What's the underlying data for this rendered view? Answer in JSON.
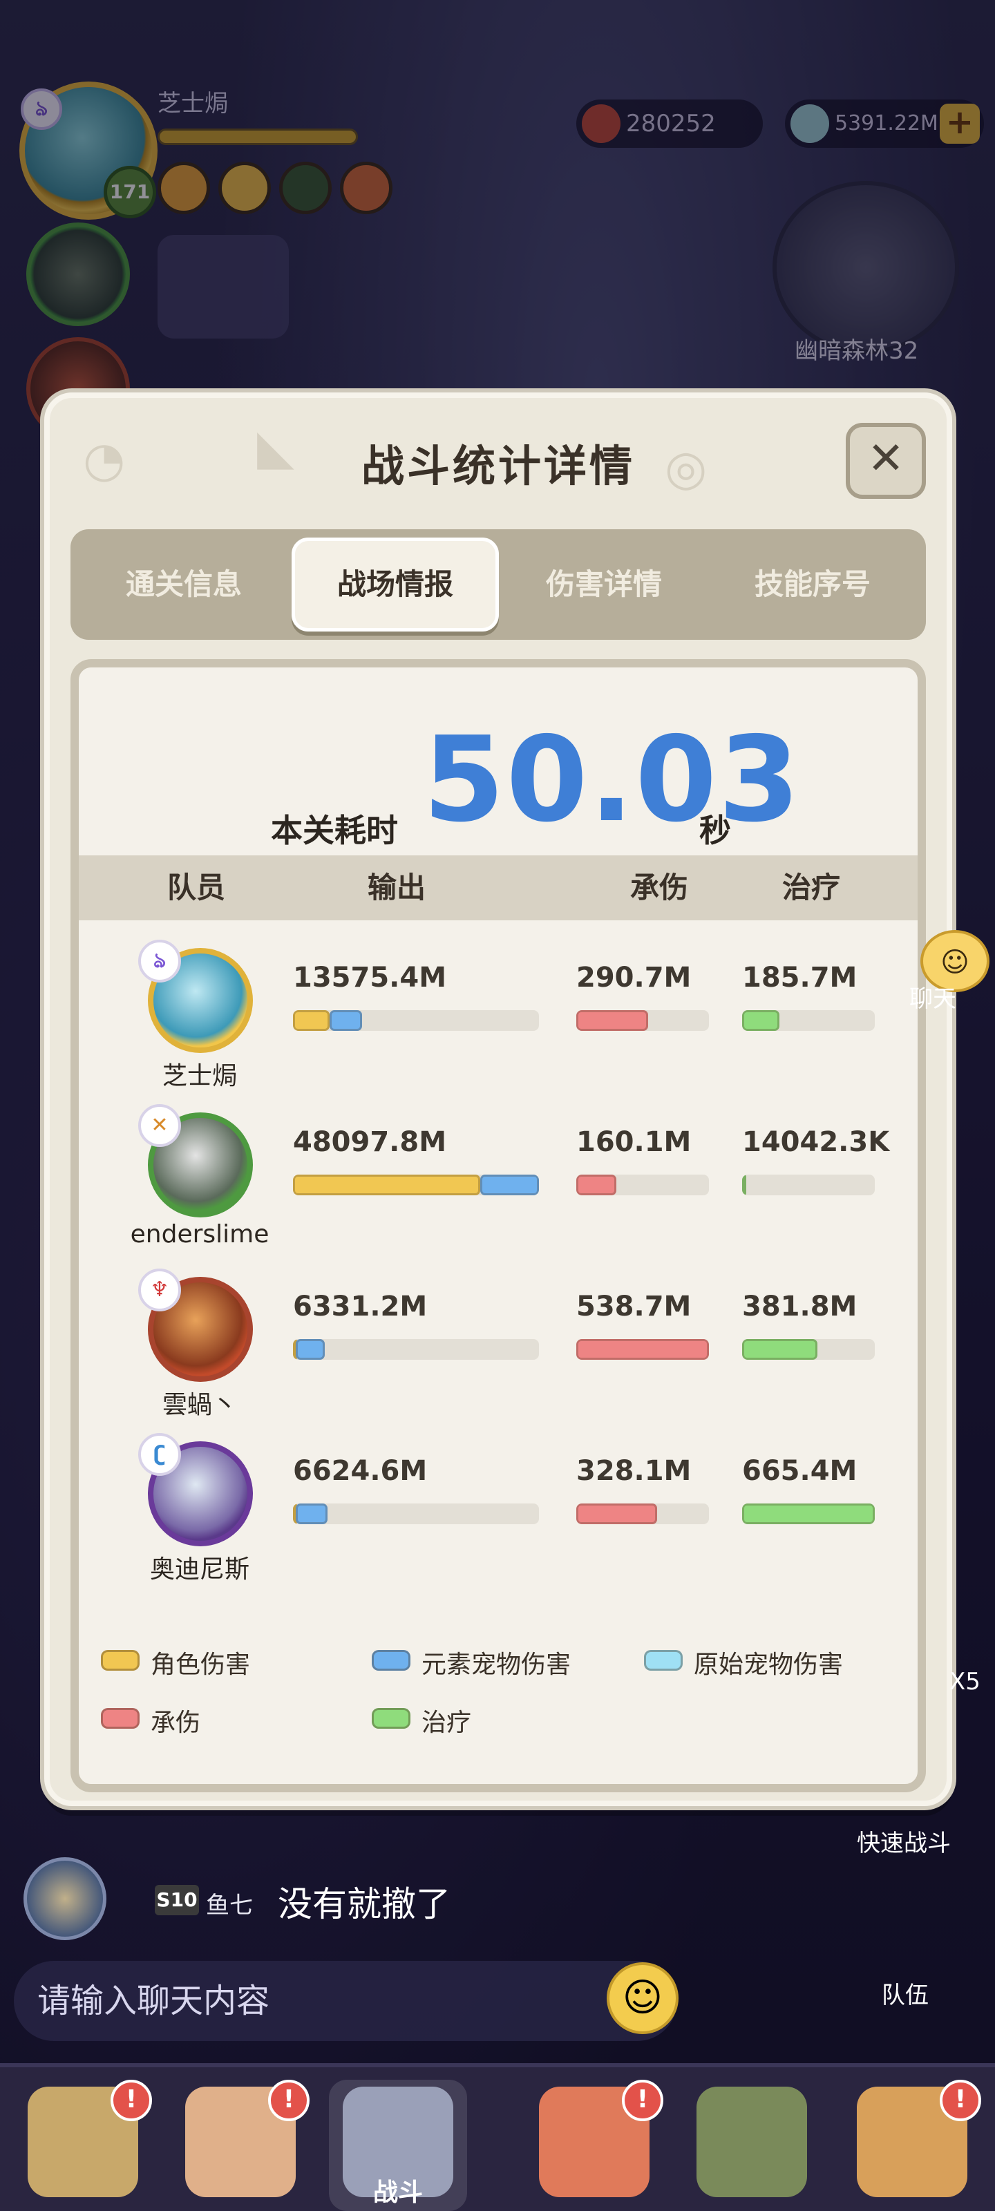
{
  "hud": {
    "player_name": "芝士焗",
    "player_level": "171",
    "currency_starfish": "280252",
    "currency_shell": "5391.22M",
    "minimap_label": "幽暗森林32",
    "colors": {
      "gold": "#e7b73c",
      "accent_blue": "#3f7fd6"
    }
  },
  "modal": {
    "title": "战斗统计详情",
    "close_icon": "close-icon",
    "tabs": [
      {
        "label": "通关信息",
        "active": false
      },
      {
        "label": "战场情报",
        "active": true
      },
      {
        "label": "伤害详情",
        "active": false
      },
      {
        "label": "技能序号",
        "active": false
      }
    ],
    "time": {
      "label": "本关耗时",
      "value": "50.03",
      "unit": "秒"
    },
    "columns": [
      "队员",
      "输出",
      "承伤",
      "治疗"
    ],
    "rows": [
      {
        "name": "芝士焗",
        "element_icon": "wind-element-icon",
        "output": "13575.4M",
        "output_role_fraction": 0.15,
        "output_element_pet_fraction": 0.13,
        "taken": "290.7M",
        "taken_fraction": 0.54,
        "heal": "185.7M",
        "heal_fraction": 0.28
      },
      {
        "name": "enderslime",
        "element_icon": "earth-element-icon",
        "output": "48097.8M",
        "output_role_fraction": 0.76,
        "output_element_pet_fraction": 0.24,
        "taken": "160.1M",
        "taken_fraction": 0.3,
        "heal": "14042.3K",
        "heal_fraction": 0.02
      },
      {
        "name": "雲蝸丶",
        "element_icon": "fire-element-icon",
        "output": "6331.2M",
        "output_role_fraction": 0.01,
        "output_element_pet_fraction": 0.12,
        "taken": "538.7M",
        "taken_fraction": 1.0,
        "heal": "381.8M",
        "heal_fraction": 0.57
      },
      {
        "name": "奥迪尼斯",
        "element_icon": "water-element-icon",
        "output": "6624.6M",
        "output_role_fraction": 0.01,
        "output_element_pet_fraction": 0.13,
        "taken": "328.1M",
        "taken_fraction": 0.61,
        "heal": "665.4M",
        "heal_fraction": 1.0
      }
    ],
    "legend": [
      {
        "label": "角色伤害",
        "color": "#f1c752"
      },
      {
        "label": "元素宠物伤害",
        "color": "#6fb1ee"
      },
      {
        "label": "原始宠物伤害",
        "color": "#9fe0f4"
      },
      {
        "label": "承伤",
        "color": "#ee8484"
      },
      {
        "label": "治疗",
        "color": "#8fdc7c"
      }
    ]
  },
  "chat": {
    "bubble_label": "聊天",
    "last_user_rank": "S10",
    "last_user": "鱼七",
    "last_message": "没有就撤了",
    "input_placeholder": "请输入聊天内容"
  },
  "side": {
    "quick_battle": "快速战斗",
    "team": "队伍",
    "x5": "X5"
  },
  "nav": {
    "items": [
      {
        "label": "",
        "icon": "tribe-icon"
      },
      {
        "label": "",
        "icon": "hero-icon"
      },
      {
        "label": "战斗",
        "icon": "battle-sword-icon",
        "active": true
      },
      {
        "label": "",
        "icon": "pet-icon"
      },
      {
        "label": "",
        "icon": "camp-icon"
      },
      {
        "label": "",
        "icon": "totem-icon"
      }
    ],
    "badge": "!"
  }
}
